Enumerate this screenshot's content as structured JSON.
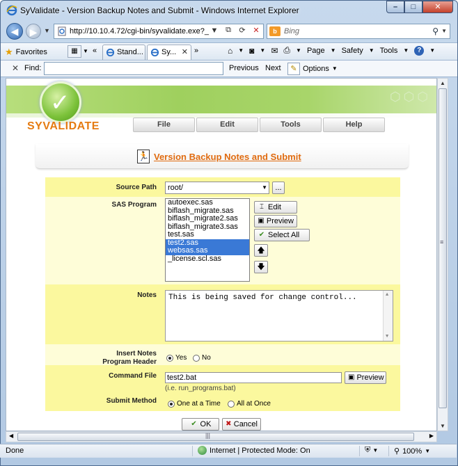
{
  "window": {
    "title": "SyValidate - Version Backup Notes and Submit - Windows Internet Explorer",
    "controls": {
      "minimize": "–",
      "maximize": "□",
      "close": "✕"
    }
  },
  "address": {
    "url": "http://10.10.4.72/cgi-bin/syvalidate.exe?_",
    "search_placeholder": "Bing"
  },
  "favorites_bar": {
    "favorites_label": "Favorites",
    "tabs": [
      {
        "label": "Stand..."
      },
      {
        "label": "Sy..."
      }
    ],
    "commands": {
      "page": "Page",
      "safety": "Safety",
      "tools": "Tools"
    }
  },
  "find_bar": {
    "label": "Find:",
    "value": "",
    "previous": "Previous",
    "next": "Next",
    "options": "Options"
  },
  "app": {
    "brand": "SYVALIDATE",
    "menu": [
      "File",
      "Edit",
      "Tools",
      "Help"
    ],
    "page_title": "Version Backup Notes and Submit"
  },
  "form": {
    "source_path": {
      "label": "Source Path",
      "value": "root/",
      "browse": "..."
    },
    "sas_program": {
      "label": "SAS Program",
      "items": [
        {
          "name": "autoexec.sas",
          "selected": false
        },
        {
          "name": "biflash_migrate.sas",
          "selected": false
        },
        {
          "name": "biflash_migrate2.sas",
          "selected": false
        },
        {
          "name": "biflash_migrate3.sas",
          "selected": false
        },
        {
          "name": "test.sas",
          "selected": false
        },
        {
          "name": "test2.sas",
          "selected": true
        },
        {
          "name": "websas.sas",
          "selected": true
        },
        {
          "name": "_license.scl.sas",
          "selected": false
        }
      ],
      "edit": "Edit",
      "preview": "Preview",
      "select_all": "Select All"
    },
    "notes": {
      "label": "Notes",
      "value": "This is being saved for change control..."
    },
    "insert_notes": {
      "label_line1": "Insert Notes",
      "label_line2": "Program Header",
      "yes": "Yes",
      "no": "No",
      "selected": "yes"
    },
    "command_file": {
      "label": "Command File",
      "value": "test2.bat",
      "hint": "(i.e. run_programs.bat)",
      "preview": "Preview"
    },
    "submit_method": {
      "label": "Submit Method",
      "one_at_a_time": "One at a Time",
      "all_at_once": "All at Once",
      "selected": "one"
    },
    "ok": "OK",
    "cancel": "Cancel"
  },
  "status": {
    "left": "Done",
    "zone": "Internet | Protected Mode: On",
    "zoom": "100%"
  }
}
